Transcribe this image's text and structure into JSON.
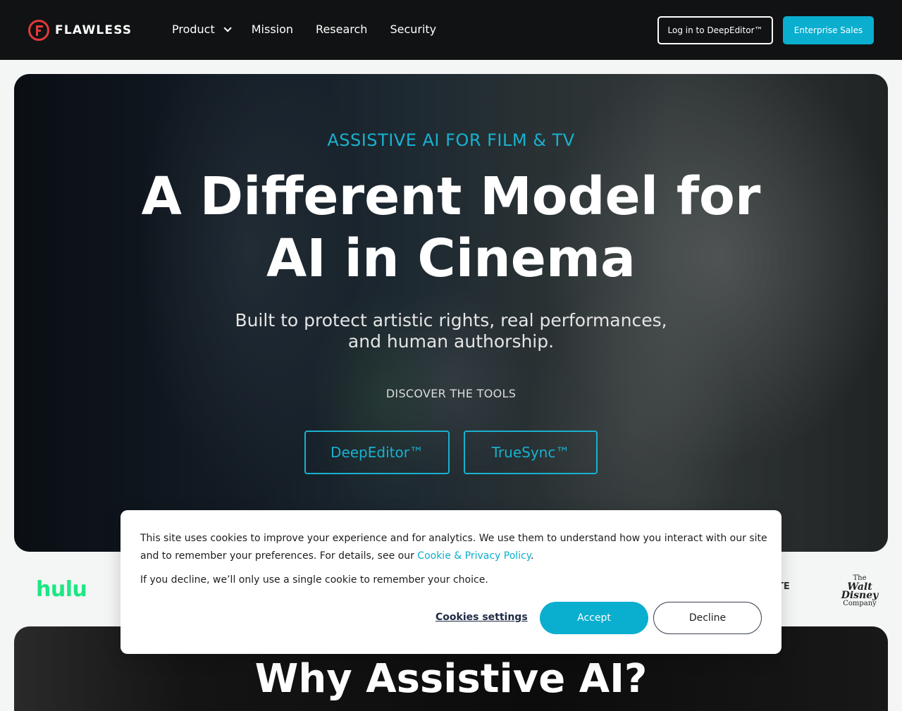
{
  "brand": {
    "name": "FLAWLESS",
    "accent": "#e03a3a"
  },
  "nav": {
    "links": [
      {
        "label": "Product",
        "icon": "chevron-down-icon"
      },
      {
        "label": "Mission"
      },
      {
        "label": "Research"
      },
      {
        "label": "Security"
      }
    ],
    "login_label": "Log in to DeepEditor™",
    "enterprise_label": "Enterprise Sales"
  },
  "hero": {
    "eyebrow": "ASSISTIVE AI FOR FILM & TV",
    "title_line1": "A Different Model for",
    "title_line2": "AI in Cinema",
    "subtitle_line1": "Built to protect artistic rights, real performances,",
    "subtitle_line2": "and human authorship.",
    "discover": "DISCOVER THE TOOLS",
    "tools": [
      "DeepEditor™",
      "TrueSync™"
    ]
  },
  "logos": {
    "hulu": "hulu",
    "partial_logo": "ATE",
    "disney_line1": "The",
    "disney_line2": "Walt Disney",
    "disney_line3": "Company"
  },
  "section2": {
    "title": "Why Assistive AI?"
  },
  "cookie": {
    "text_before_link": "This site uses cookies to improve your experience and for analytics. We use them to understand how you interact with our site and to remember your preferences. For details, see our ",
    "link_label": "Cookie & Privacy Policy",
    "text_after_link": ".",
    "text2": "If you decline, we’ll only use a single cookie to remember your choice.",
    "settings_label": "Cookies settings",
    "accept_label": "Accept",
    "decline_label": "Decline"
  },
  "colors": {
    "primary": "#0aaecf",
    "nav_bg": "#111213",
    "hulu": "#1ce783"
  }
}
